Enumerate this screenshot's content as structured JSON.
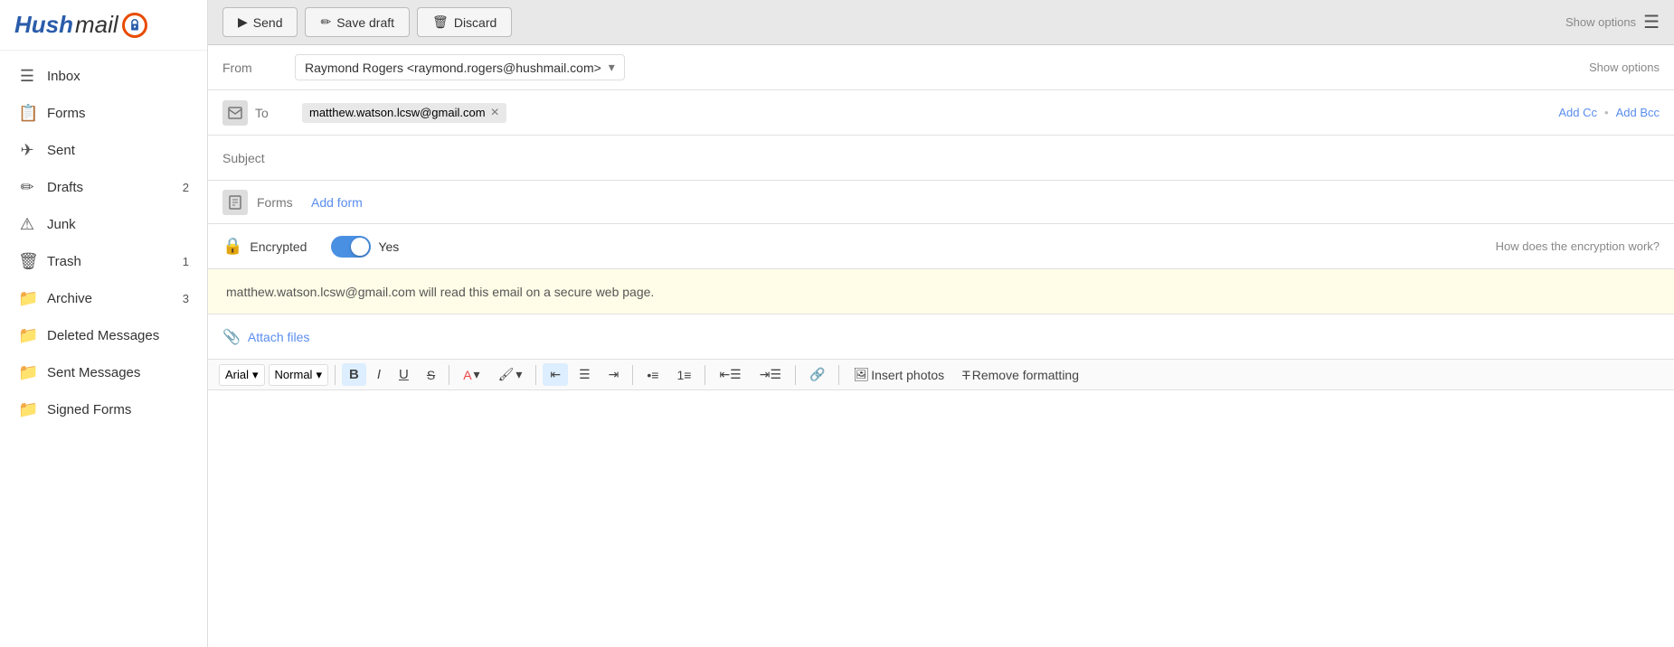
{
  "sidebar": {
    "logo": {
      "hush": "Hush",
      "mail": "mail"
    },
    "items": [
      {
        "id": "inbox",
        "label": "Inbox",
        "icon": "☰",
        "badge": ""
      },
      {
        "id": "forms",
        "label": "Forms",
        "icon": "📋",
        "badge": ""
      },
      {
        "id": "sent",
        "label": "Sent",
        "icon": "✈",
        "badge": ""
      },
      {
        "id": "drafts",
        "label": "Drafts",
        "icon": "✏",
        "badge": "2"
      },
      {
        "id": "junk",
        "label": "Junk",
        "icon": "⚠",
        "badge": ""
      },
      {
        "id": "trash",
        "label": "Trash",
        "icon": "🗑",
        "badge": "1"
      },
      {
        "id": "archive",
        "label": "Archive",
        "icon": "📁",
        "badge": "3"
      },
      {
        "id": "deleted",
        "label": "Deleted Messages",
        "icon": "📁",
        "badge": ""
      },
      {
        "id": "sent-messages",
        "label": "Sent Messages",
        "icon": "📁",
        "badge": ""
      },
      {
        "id": "signed-forms",
        "label": "Signed Forms",
        "icon": "📁",
        "badge": ""
      }
    ]
  },
  "toolbar": {
    "send_label": "Send",
    "save_draft_label": "Save draft",
    "discard_label": "Discard",
    "show_options_label": "Show options"
  },
  "compose": {
    "from_label": "From",
    "from_value": "Raymond Rogers <raymond.rogers@hushmail.com>",
    "to_label": "To",
    "to_recipient": "matthew.watson.lcsw@gmail.com",
    "add_cc_label": "Add Cc",
    "add_bcc_label": "Add Bcc",
    "separator": "•",
    "subject_label": "Subject",
    "subject_placeholder": "",
    "forms_label": "Forms",
    "add_form_label": "Add form",
    "encrypted_label": "Encrypted",
    "encrypted_value": "Yes",
    "how_encryption_label": "How does the encryption work?",
    "encryption_notice": "matthew.watson.lcsw@gmail.com will read this email on a secure web page.",
    "attach_label": "Attach files",
    "format": {
      "font_label": "Arial",
      "size_label": "Normal",
      "bold": "B",
      "italic": "I",
      "underline": "U",
      "strikethrough": "S",
      "insert_photos": "Insert photos",
      "remove_formatting": "Remove formatting"
    }
  }
}
